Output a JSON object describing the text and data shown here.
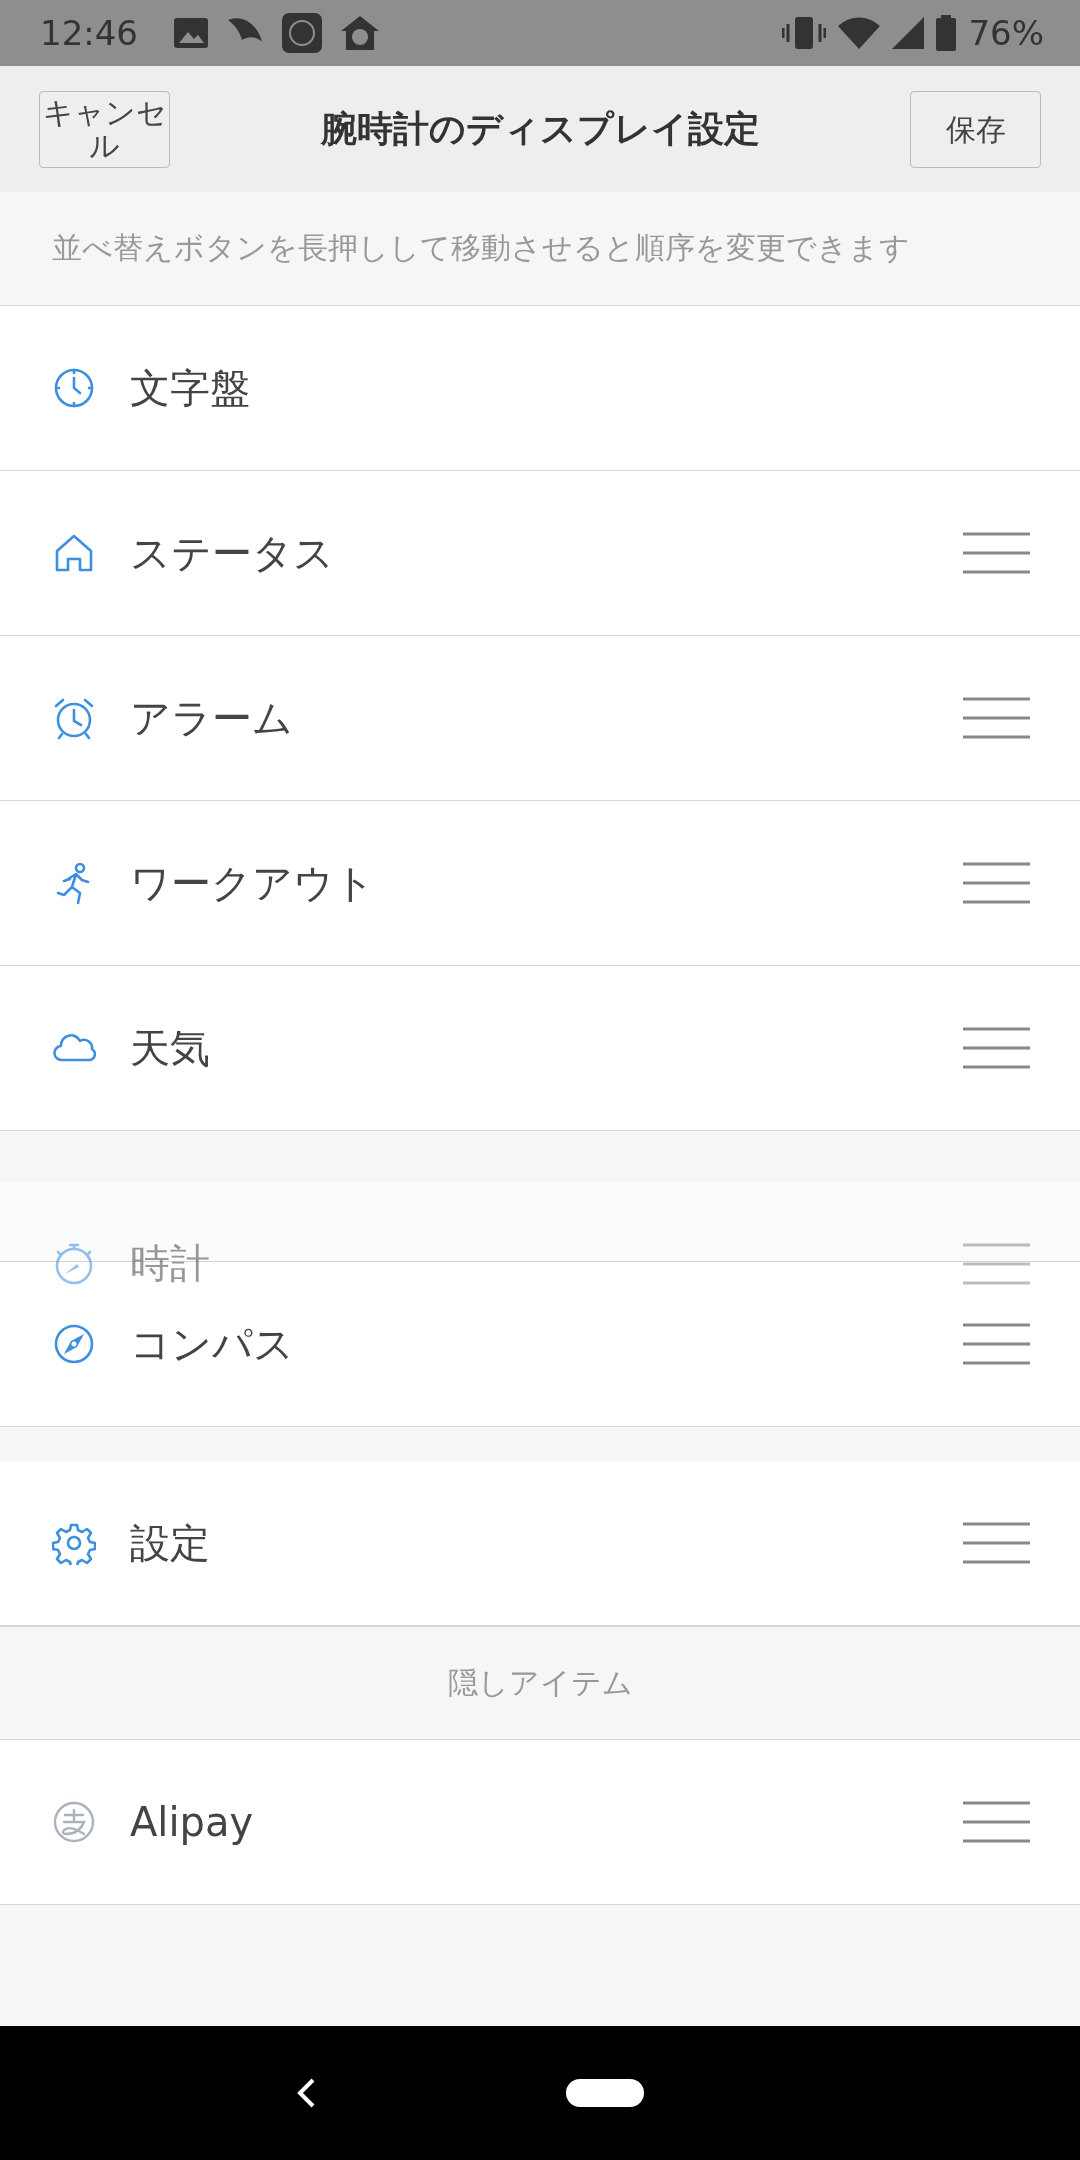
{
  "status_bar": {
    "time": "12:46",
    "battery": "76%"
  },
  "header": {
    "cancel": "キャンセル",
    "title": "腕時計のディスプレイ設定",
    "save": "保存"
  },
  "hint": "並べ替えボタンを長押しして移動させると順序を変更できます",
  "sections": [
    {
      "items": [
        {
          "label": "文字盤",
          "kind": "watchface",
          "draggable": false,
          "dragging": false
        },
        {
          "label": "ステータス",
          "kind": "home",
          "draggable": true,
          "dragging": false
        },
        {
          "label": "アラーム",
          "kind": "alarm",
          "draggable": true,
          "dragging": false
        },
        {
          "label": "ワークアウト",
          "kind": "runner",
          "draggable": true,
          "dragging": false
        },
        {
          "label": "天気",
          "kind": "cloud",
          "draggable": true,
          "dragging": false
        }
      ]
    },
    {
      "items": [
        {
          "label": "時計",
          "kind": "stopwatch",
          "draggable": true,
          "dragging": true
        },
        {
          "label": "コンパス",
          "kind": "compass",
          "draggable": true,
          "dragging": false
        }
      ]
    },
    {
      "items": [
        {
          "label": "設定",
          "kind": "gear",
          "draggable": true,
          "dragging": false
        }
      ]
    },
    {
      "title": "隠しアイテム",
      "items": [
        {
          "label": "Alipay",
          "kind": "alipay",
          "draggable": true,
          "dragging": false
        }
      ]
    }
  ]
}
